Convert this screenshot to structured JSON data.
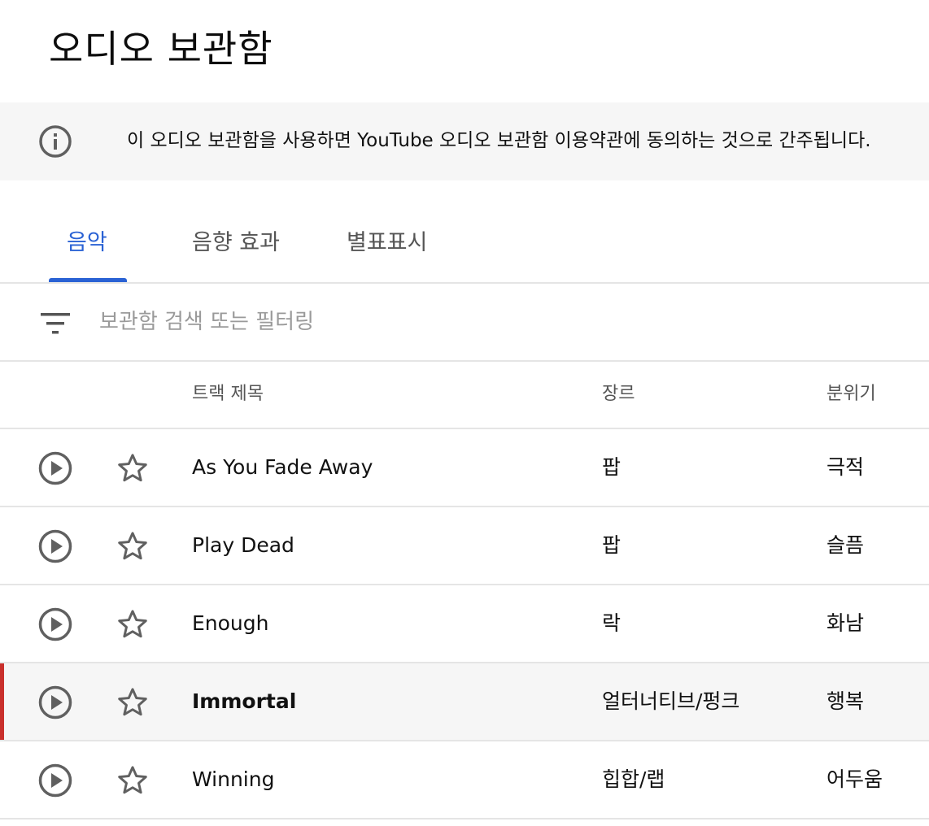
{
  "page": {
    "title": "오디오 보관함"
  },
  "notice": {
    "text": "이 오디오 보관함을 사용하면 YouTube 오디오 보관함 이용약관에 동의하는 것으로 간주됩니다."
  },
  "tabs": [
    {
      "label": "음악",
      "active": true
    },
    {
      "label": "음향 효과",
      "active": false
    },
    {
      "label": "별표표시",
      "active": false
    }
  ],
  "search": {
    "placeholder": "보관함 검색 또는 필터링",
    "value": ""
  },
  "table": {
    "headers": {
      "title": "트랙 제목",
      "genre": "장르",
      "mood": "분위기"
    },
    "rows": [
      {
        "title": "As You Fade Away",
        "genre": "팝",
        "mood": "극적",
        "selected": false
      },
      {
        "title": "Play Dead",
        "genre": "팝",
        "mood": "슬픔",
        "selected": false
      },
      {
        "title": "Enough",
        "genre": "락",
        "mood": "화남",
        "selected": false
      },
      {
        "title": "Immortal",
        "genre": "얼터너티브/펑크",
        "mood": "행복",
        "selected": true
      },
      {
        "title": "Winning",
        "genre": "힙합/랩",
        "mood": "어두움",
        "selected": false
      }
    ]
  },
  "colors": {
    "accent": "#2a62d4",
    "selected_marker": "#c9302c",
    "notice_bg": "#f6f6f6"
  }
}
